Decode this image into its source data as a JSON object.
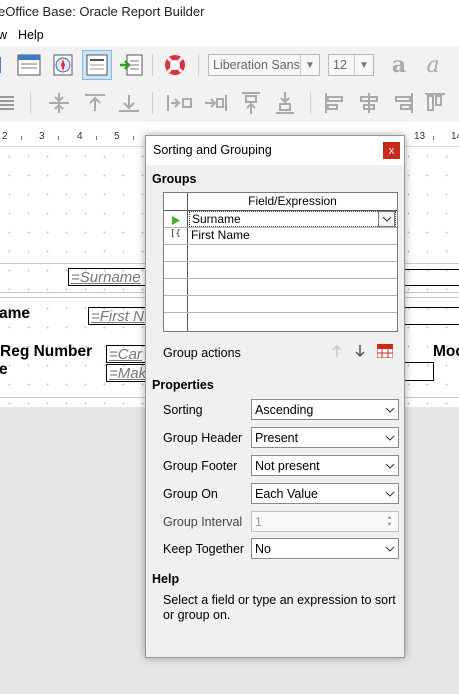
{
  "window": {
    "title": "eOffice Base: Oracle Report Builder"
  },
  "menu": {
    "items": [
      "w",
      "Help"
    ]
  },
  "toolbar": {
    "font_name": "Liberation Sans",
    "font_size": "12"
  },
  "ruler": {
    "numbers": [
      "2",
      "3",
      "4",
      "5",
      "13",
      "14"
    ]
  },
  "report": {
    "surname_field": "=Surname",
    "first_name_label": "ame",
    "first_name_field": "=First N",
    "reg_label": "Reg Number",
    "reg_label_2": "e",
    "car_field": "=Car",
    "make_field": "=Mak",
    "mod_label": "Moc"
  },
  "dialog": {
    "title": "Sorting and Grouping",
    "close_label": "x",
    "groups_heading": "Groups",
    "column_header": "Field/Expression",
    "rows": [
      "Surname",
      "First Name"
    ],
    "group_actions_label": "Group actions",
    "properties_heading": "Properties",
    "properties": {
      "sorting": {
        "label": "Sorting",
        "value": "Ascending"
      },
      "group_header": {
        "label": "Group Header",
        "value": "Present"
      },
      "group_footer": {
        "label": "Group Footer",
        "value": "Not present"
      },
      "group_on": {
        "label": "Group On",
        "value": "Each Value"
      },
      "group_interval": {
        "label": "Group Interval",
        "value": "1"
      },
      "keep_together": {
        "label": "Keep Together",
        "value": "No"
      }
    },
    "help_heading": "Help",
    "help_text": "Select a field or type an expression to sort or group on."
  },
  "colors": {
    "accent": "#cde4f6",
    "close": "#c42b1c",
    "dialog_bg": "#f0f0f0"
  }
}
